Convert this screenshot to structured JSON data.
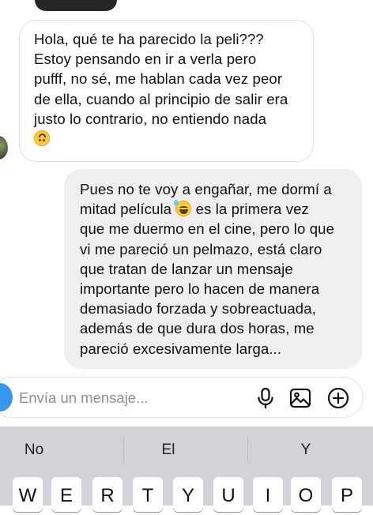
{
  "incoming_message": {
    "lines": [
      "Hola,  qué te ha parecido la peli???",
      "Estoy pensando en ir a verla pero",
      "pufff, no sé,  me hablan cada vez peor",
      "de ella, cuando al principio de salir era",
      "justo lo contrario,  no entiendo nada"
    ],
    "emoji": "upside-down-face-emoji"
  },
  "outgoing_message": {
    "line1": "Pues no te voy a engañar, me dormí a",
    "line2_before": "mitad película ",
    "line2_emoji": "grinning-sweat-emoji",
    "line2_after": " es la primera vez",
    "lines_rest": [
      "que me duermo en el cine, pero lo que",
      "vi me pareció un pelmazo, está claro",
      "que tratan de lanzar un mensaje",
      "importante pero lo hacen de manera",
      "demasiado forzada y sobreactuada,",
      "además de que dura dos horas, me",
      "pareció excesivamente larga..."
    ]
  },
  "composer": {
    "placeholder": "Envía un mensaje...",
    "icons": [
      "camera-icon",
      "microphone-icon",
      "gallery-icon",
      "add-icon"
    ],
    "accent_color": "#3797f0"
  },
  "keyboard": {
    "suggestions": [
      "No",
      "El",
      "Y"
    ],
    "top_row_keys": [
      "W",
      "E",
      "R",
      "T",
      "Y",
      "U",
      "I",
      "O",
      "P"
    ]
  }
}
